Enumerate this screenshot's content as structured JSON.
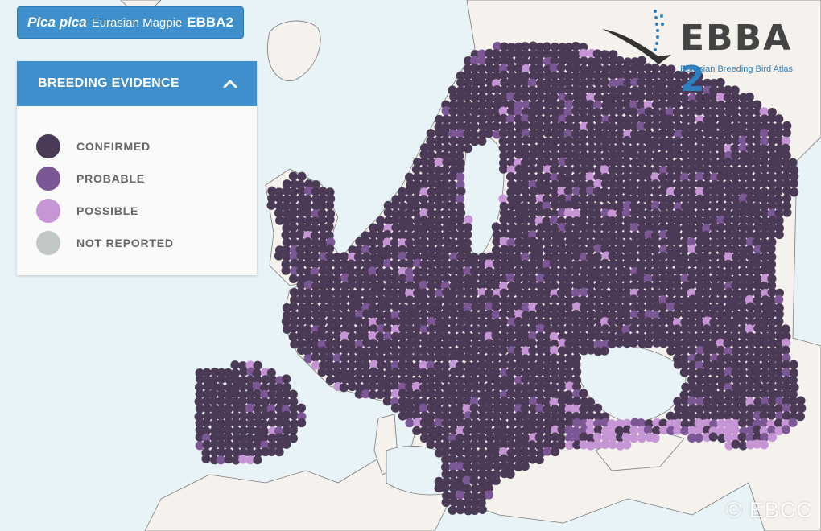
{
  "species": {
    "scientific_name": "Pica pica",
    "common_name": "Eurasian Magpie",
    "atlas": "EBBA2"
  },
  "legend": {
    "title": "BREEDING EVIDENCE",
    "toggle_icon": "chevron-up-icon",
    "items": [
      {
        "label": "CONFIRMED",
        "color": "#4b3a55"
      },
      {
        "label": "PROBABLE",
        "color": "#7c5796"
      },
      {
        "label": "POSSIBLE",
        "color": "#c695d6"
      },
      {
        "label": "NOT REPORTED",
        "color": "#c2c7c7"
      }
    ]
  },
  "logo": {
    "name": "EBBA",
    "number": "2",
    "subtitle": "Eurasian Breeding Bird Atlas"
  },
  "credit": "© EBCC",
  "colors": {
    "sea": "#e8f3f7",
    "land": "#f5f1ec",
    "accent": "#3e8fcb"
  }
}
